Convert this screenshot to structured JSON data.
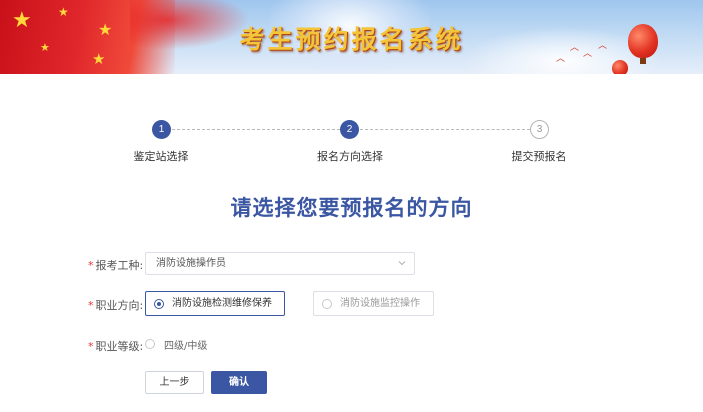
{
  "banner": {
    "title": "考生预约报名系统"
  },
  "steps": [
    {
      "number": "1",
      "label": "鉴定站选择",
      "state": "done"
    },
    {
      "number": "2",
      "label": "报名方向选择",
      "state": "current"
    },
    {
      "number": "3",
      "label": "提交预报名",
      "state": "pending"
    }
  ],
  "heading": "请选择您要预报名的方向",
  "form": {
    "exam_type": {
      "required_mark": "*",
      "label": "报考工种:",
      "value": "消防设施操作员",
      "icon": "chevron-down-icon"
    },
    "direction": {
      "required_mark": "*",
      "label": "职业方向:",
      "options": [
        {
          "label": "消防设施检测维修保养",
          "selected": true
        },
        {
          "label": "消防设施监控操作",
          "selected": false
        }
      ]
    },
    "level": {
      "required_mark": "*",
      "label": "职业等级:",
      "option": {
        "label": "四级/中级",
        "selected": false
      }
    }
  },
  "buttons": {
    "prev_label": "上一步",
    "confirm_label": "确认"
  },
  "colors": {
    "primary": "#3b57a3",
    "required": "#e5353a",
    "banner_title": "#f3c53a"
  }
}
